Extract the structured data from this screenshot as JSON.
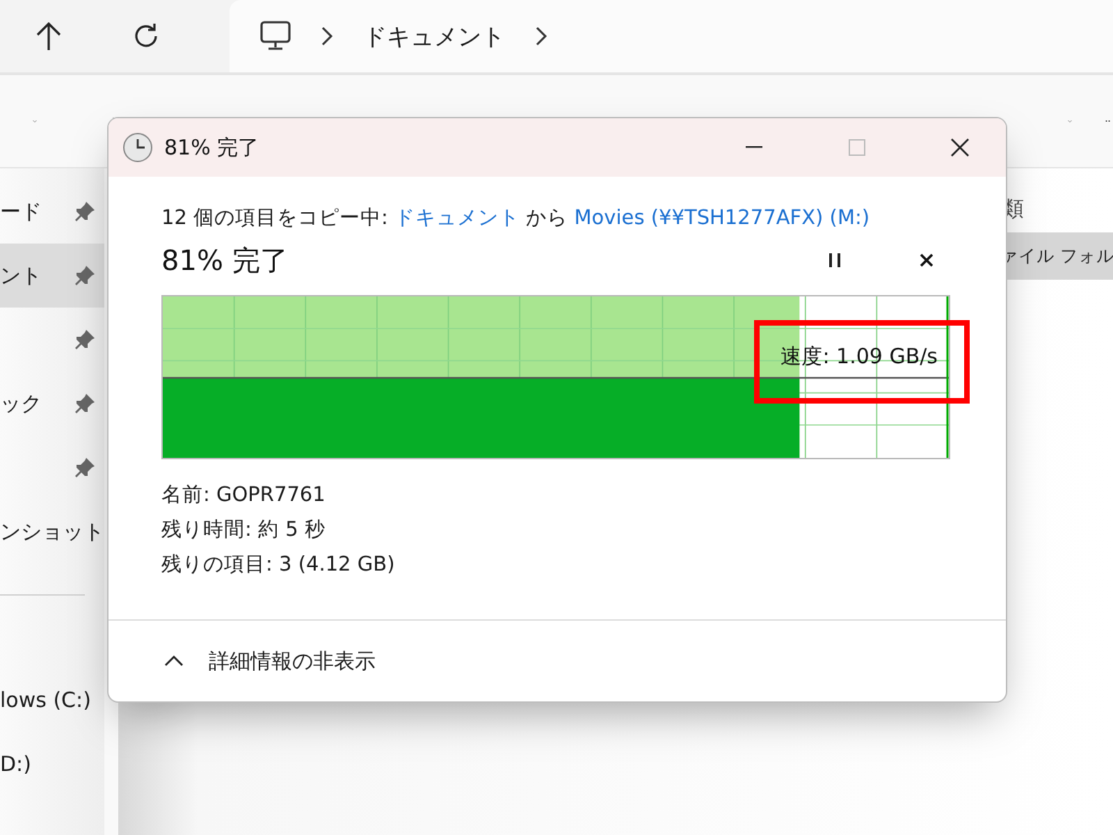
{
  "address_bar": {
    "crumbs": [
      "ドキュメント"
    ]
  },
  "sidebar": {
    "items": [
      {
        "label": "ード",
        "pinned": true,
        "selected": false
      },
      {
        "label": "ント",
        "pinned": true,
        "selected": true
      },
      {
        "pinned": true,
        "selected": false
      },
      {
        "label": "ック",
        "pinned": true,
        "selected": false
      },
      {
        "pinned": true,
        "selected": false
      },
      {
        "label": "ンショット",
        "pinned": false,
        "selected": false
      }
    ],
    "drives": [
      {
        "label": "lows (C:)"
      },
      {
        "label": "D:)"
      }
    ]
  },
  "file_list": {
    "column_header": "類",
    "rows": [
      {
        "type": "ァイル フォル",
        "selected": true
      }
    ]
  },
  "dialog": {
    "title": "81% 完了",
    "summary": {
      "prefix": "12 個の項目をコピー中: ",
      "source": "ドキュメント",
      "middle": " から ",
      "destination": "Movies (¥¥TSH1277AFX) (M:)"
    },
    "progress_heading": "81% 完了",
    "graph": {
      "level": 0.81,
      "speed": "速度: 1.09 GB/s",
      "speed_highlighted": true
    },
    "details": [
      "名前: GOPR7761",
      "残り時間: 約 5 秒",
      "残りの項目: 3 (4.12 GB)"
    ],
    "details_toggle": {
      "label": "詳細情報の非表示",
      "expanded": true
    }
  }
}
